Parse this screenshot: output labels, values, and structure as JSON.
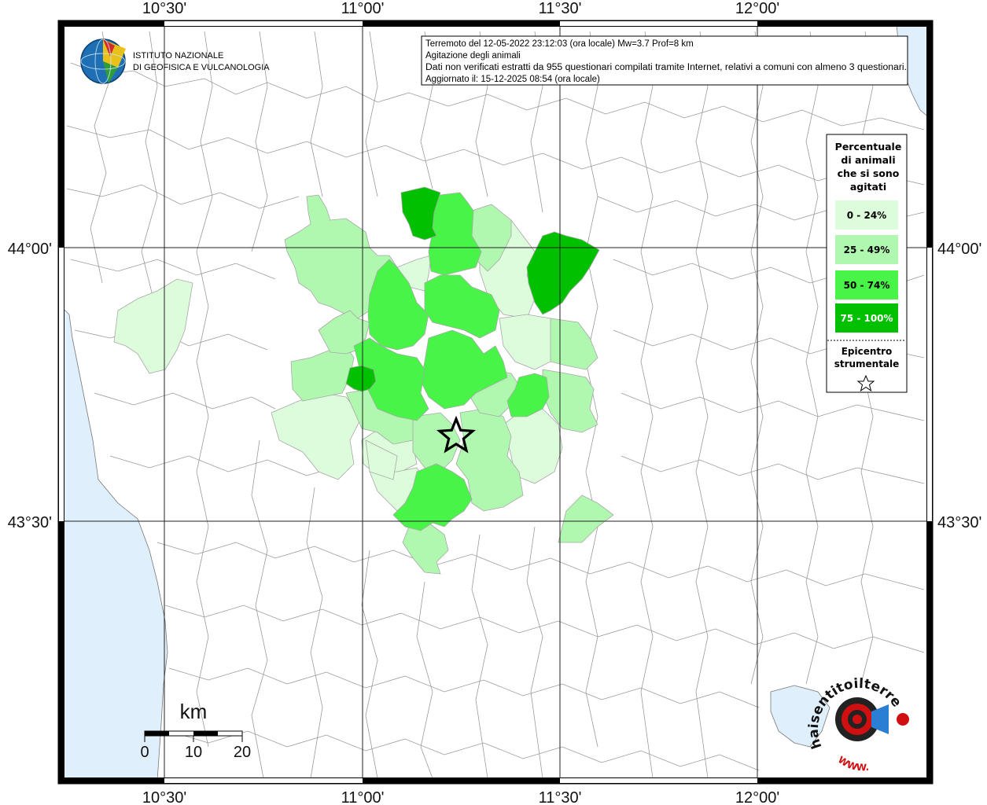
{
  "header": {
    "line1": "Terremoto del 12-05-2022 23:12:03 (ora locale) Mw=3.7 Prof=8 km",
    "line2": "Agitazione degli animali",
    "line3": "Dati non verificati estratti da 955 questionari compilati tramite Internet, relativi a comuni con almeno 3 questionari.",
    "line4": "Aggiornato il: 15-12-2025 08:54 (ora locale)"
  },
  "logo": {
    "line1": "ISTITUTO NAZIONALE",
    "line2": "DI GEOFISICA E VULCANOLOGIA"
  },
  "axes": {
    "lon_labels": [
      "10°30'",
      "11°00'",
      "11°30'",
      "12°00'"
    ],
    "lat_labels": [
      "44°00'",
      "43°30'"
    ]
  },
  "legend": {
    "title": [
      "Percentuale",
      "di animali",
      "che si sono",
      "agitati"
    ],
    "classes": [
      {
        "label": "0 - 24%",
        "color": "#dcfcdc"
      },
      {
        "label": "25 - 49%",
        "color": "#b0f8b0"
      },
      {
        "label": "50 - 74%",
        "color": "#48f448"
      },
      {
        "label": "75 - 100%",
        "color": "#00c000"
      }
    ],
    "epicenter_title": [
      "Epicentro",
      "strumentale"
    ]
  },
  "scale": {
    "unit": "km",
    "ticks": [
      "0",
      "10",
      "20"
    ]
  },
  "watermark": {
    "brand": "haisentitoilterremoto.it",
    "url": "WWW."
  },
  "colors": {
    "sea": "#dff0fc",
    "border": "#888888",
    "grid": "#222222"
  }
}
